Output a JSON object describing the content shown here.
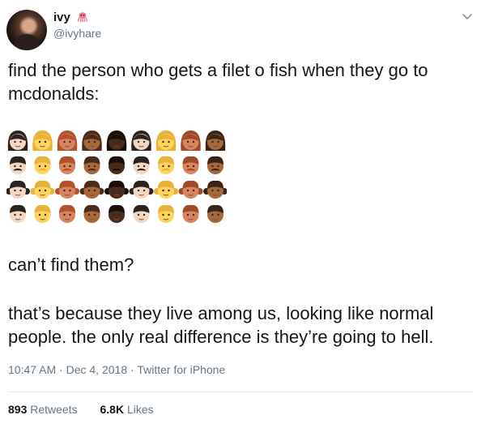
{
  "author": {
    "name": "ivy",
    "handle": "@ivyhare",
    "name_emoji_icon": "octopus-icon",
    "avatar_icon": "profile-photo"
  },
  "tweet": {
    "line1": "find the person who gets a filet o fish when they go to mcdonalds:",
    "line2": "can’t find them?",
    "line3": "that’s because they live among us, looking like normal people. the only real difference is they’re going to hell.",
    "emoji_grid": {
      "rows": [
        "woman",
        "man-with-moustache",
        "woman-with-pigtails",
        "boy"
      ],
      "skin_tones": [
        "#f2d7c4",
        "#ffd45c",
        "#d8855f",
        "#a5693b",
        "#4a2b1c",
        "#f2d7c4",
        "#ffd45c",
        "#d8855f",
        "#a5693b"
      ]
    }
  },
  "meta": {
    "time": "10:47 AM",
    "date": "Dec 4, 2018",
    "source": "Twitter for iPhone",
    "separator": "·"
  },
  "stats": {
    "retweets_count": "893",
    "retweets_label": "Retweets",
    "likes_count": "6.8K",
    "likes_label": "Likes"
  },
  "colors": {
    "text": "#14171a",
    "secondary": "#657786",
    "divider": "#e6ecf0"
  }
}
